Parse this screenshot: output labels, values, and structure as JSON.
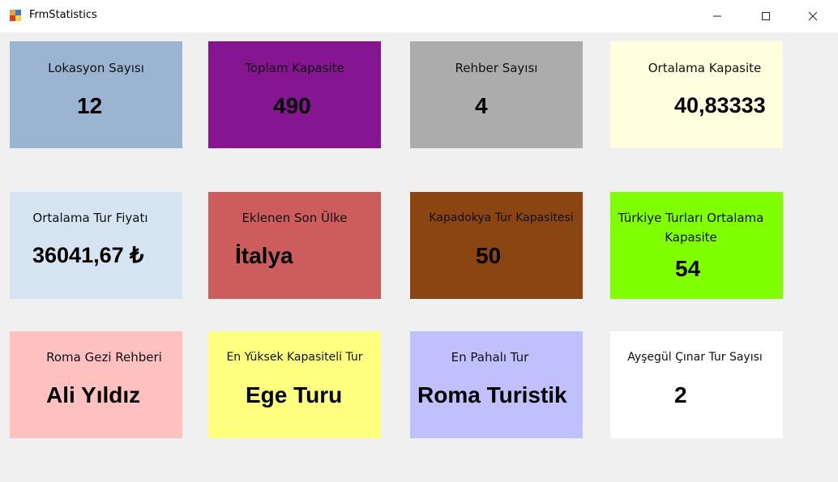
{
  "window": {
    "title": "FrmStatistics",
    "minimize_icon": "minimize-icon",
    "maximize_icon": "maximize-icon",
    "close_icon": "close-icon"
  },
  "cards": [
    {
      "label": "Lokasyon Sayısı",
      "value": "12",
      "color": "#9bb4d2"
    },
    {
      "label": "Toplam Kapasite",
      "value": "490",
      "color": "#861591"
    },
    {
      "label": "Rehber Sayısı",
      "value": "4",
      "color": "#acacac"
    },
    {
      "label": "Ortalama Kapasite",
      "value": "40,83333",
      "color": "#ffffe0"
    },
    {
      "label": "Ortalama Tur Fiyatı",
      "value": "36041,67 ₺",
      "color": "#d6e3f0"
    },
    {
      "label": "Eklenen Son Ülke",
      "value": "İtalya",
      "color": "#cd5c5c"
    },
    {
      "label": "Kapadokya Tur Kapasitesi",
      "value": "50",
      "color": "#8b4513"
    },
    {
      "label": "Türkiye Turları Ortalama",
      "label2": "Kapasite",
      "value": "54",
      "color": "#7fff00"
    },
    {
      "label": "Roma Gezi Rehberi",
      "value": "Ali Yıldız",
      "color": "#ffc0c0"
    },
    {
      "label": "En Yüksek Kapasiteli Tur",
      "value": "Ege Turu",
      "color": "#ffff80"
    },
    {
      "label": "En Pahalı Tur",
      "value": "Roma Turistik",
      "color": "#c0c0ff"
    },
    {
      "label": "Ayşegül Çınar Tur Sayısı",
      "value": "2",
      "color": "#ffffff"
    }
  ]
}
